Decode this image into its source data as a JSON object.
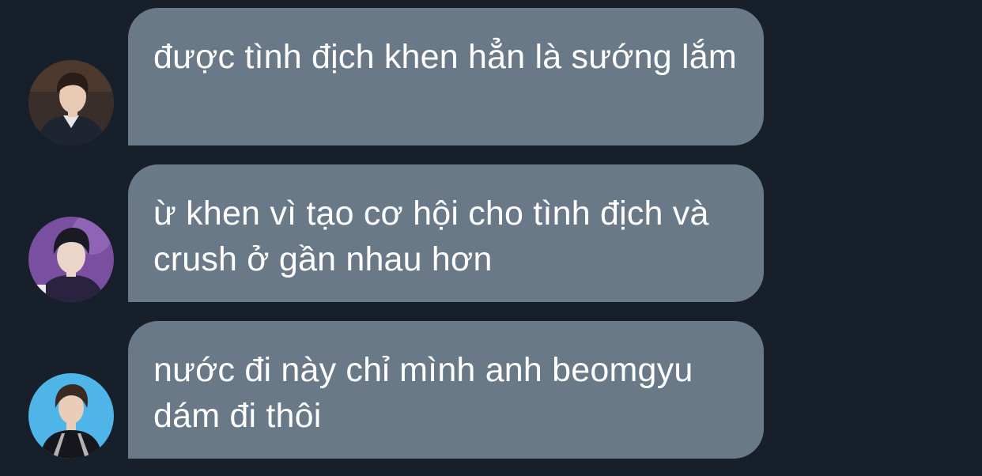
{
  "conversation": {
    "messages": [
      {
        "text": "được tình địch khen hẳn là sướng lắm",
        "avatar": {
          "icon": "user-avatar-1",
          "background": "#3a2e2a",
          "skin": "#e8c9b3",
          "hair": "#2a1d18",
          "clothes": "#1f2530"
        }
      },
      {
        "text": "ừ khen vì tạo cơ hội cho tình địch và crush ở gần nhau hơn",
        "avatar": {
          "icon": "user-avatar-2",
          "background": "#7a4fa0",
          "skin": "#ead5c8",
          "hair": "#1a1a24",
          "clothes": "#2a2340"
        }
      },
      {
        "text": "nước đi này chỉ mình anh beomgyu dám đi thôi",
        "avatar": {
          "icon": "user-avatar-3",
          "background": "#4fb4e8",
          "skin": "#e9cdb8",
          "hair": "#3a2a22",
          "clothes": "#15171c"
        }
      }
    ]
  }
}
